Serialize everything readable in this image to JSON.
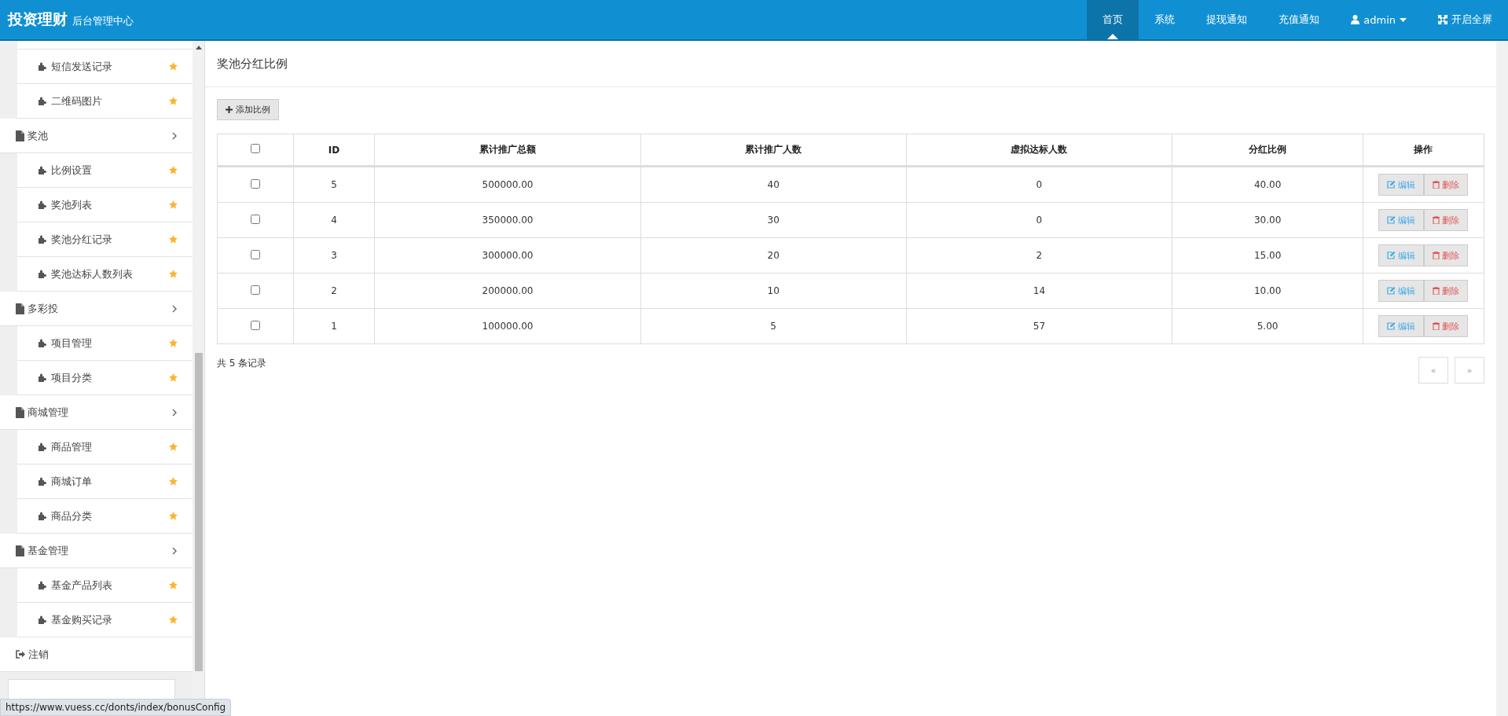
{
  "header": {
    "brand": "投资理财",
    "subtitle": "后台管理中心",
    "nav": [
      {
        "label": "首页",
        "selected": true,
        "kind": "text"
      },
      {
        "label": "系统",
        "selected": false,
        "kind": "text"
      },
      {
        "label": "提现通知",
        "selected": false,
        "kind": "text"
      },
      {
        "label": "充值通知",
        "selected": false,
        "kind": "text"
      },
      {
        "label": "admin",
        "selected": false,
        "kind": "user"
      },
      {
        "label": "开启全屏",
        "selected": false,
        "kind": "fullscreen"
      }
    ]
  },
  "sidebar": {
    "top_items": [
      {
        "label": "短信发送记录"
      },
      {
        "label": "二维码图片"
      }
    ],
    "groups": [
      {
        "label": "奖池",
        "children": [
          {
            "label": "比例设置"
          },
          {
            "label": "奖池列表"
          },
          {
            "label": "奖池分红记录"
          },
          {
            "label": "奖池达标人数列表"
          }
        ]
      },
      {
        "label": "多彩投",
        "children": [
          {
            "label": "项目管理"
          },
          {
            "label": "项目分类"
          }
        ]
      },
      {
        "label": "商城管理",
        "children": [
          {
            "label": "商品管理"
          },
          {
            "label": "商城订单"
          },
          {
            "label": "商品分类"
          }
        ]
      },
      {
        "label": "基金管理",
        "children": [
          {
            "label": "基金产品列表"
          },
          {
            "label": "基金购买记录"
          }
        ]
      }
    ],
    "logout": "注销"
  },
  "page": {
    "title": "奖池分红比例",
    "add_button": "添加比例",
    "table": {
      "columns": [
        "ID",
        "累计推广总额",
        "累计推广人数",
        "虚拟达标人数",
        "分红比例",
        "操作"
      ],
      "header_checked": false,
      "rows": [
        {
          "checked": false,
          "cells": [
            "5",
            "500000.00",
            "40",
            "0",
            "40.00"
          ],
          "edit": "编辑",
          "delete": "删除"
        },
        {
          "checked": false,
          "cells": [
            "4",
            "350000.00",
            "30",
            "0",
            "30.00"
          ],
          "edit": "编辑",
          "delete": "删除"
        },
        {
          "checked": false,
          "cells": [
            "3",
            "300000.00",
            "20",
            "2",
            "15.00"
          ],
          "edit": "编辑",
          "delete": "删除"
        },
        {
          "checked": false,
          "cells": [
            "2",
            "200000.00",
            "10",
            "14",
            "10.00"
          ],
          "edit": "编辑",
          "delete": "删除"
        },
        {
          "checked": false,
          "cells": [
            "1",
            "100000.00",
            "5",
            "57",
            "5.00"
          ],
          "edit": "编辑",
          "delete": "删除"
        }
      ]
    },
    "summary": "共 5 条记录",
    "pager": {
      "prev": "«",
      "next": "»"
    }
  },
  "status_bar": "https://www.vuess.cc/donts/index/bonusConfig"
}
